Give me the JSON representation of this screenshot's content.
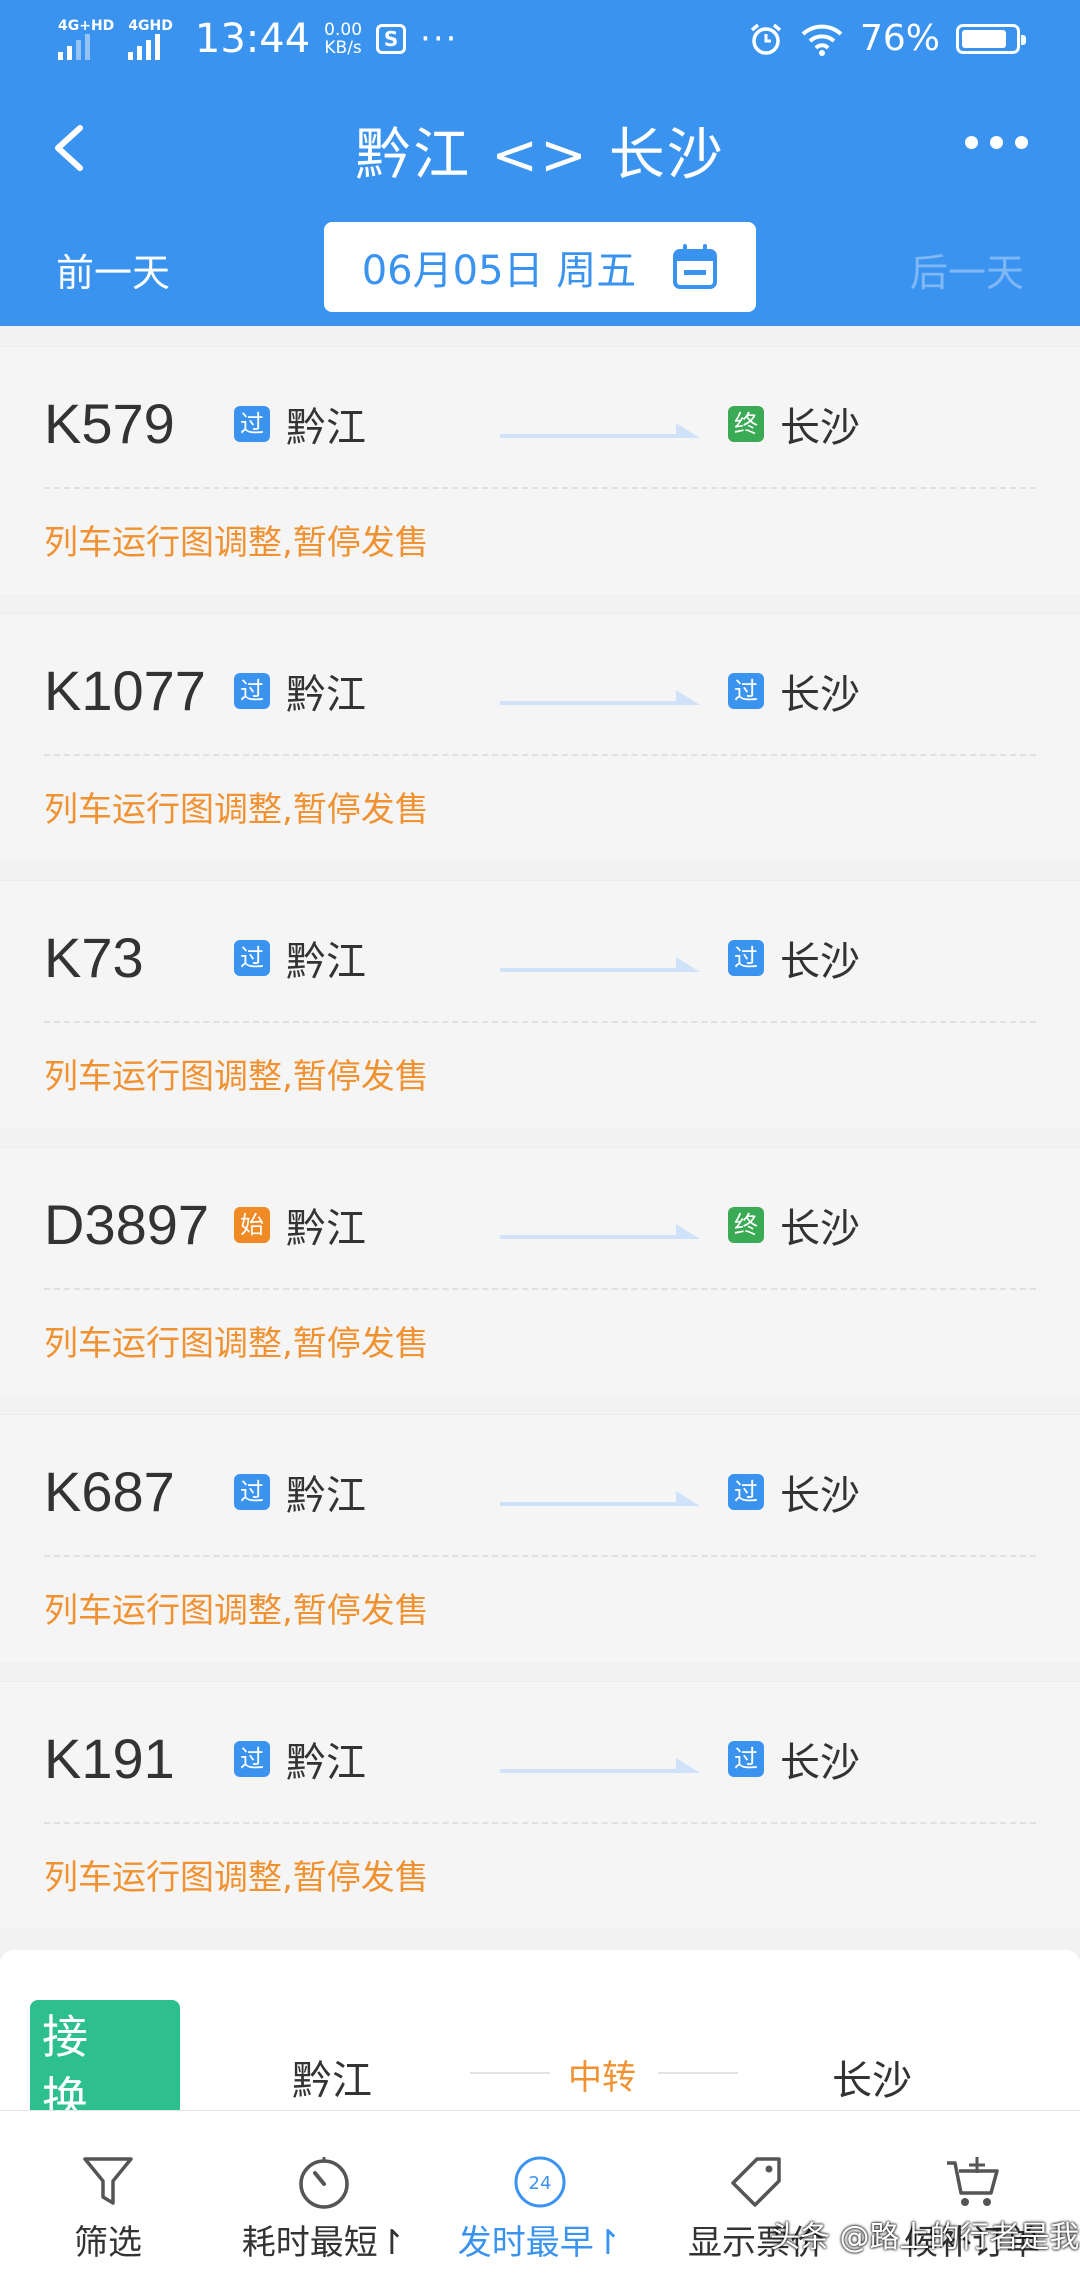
{
  "status_bar": {
    "net1": "4G+HD",
    "net2": "4GHD",
    "time": "13:44",
    "speed_value": "0.00",
    "speed_unit": "KB/s",
    "more": "···",
    "battery": "76%",
    "battery_level": 0.76
  },
  "header": {
    "title": "黔江 <> 长沙",
    "prev_day": "前一天",
    "date": "06月05日 周五",
    "next_day": "后一天"
  },
  "trains": [
    {
      "no": "K579",
      "from_tag": "过",
      "from": "黔江",
      "to_tag": "终",
      "to": "长沙",
      "notice": "列车运行图调整,暂停发售"
    },
    {
      "no": "K1077",
      "from_tag": "过",
      "from": "黔江",
      "to_tag": "过",
      "to": "长沙",
      "notice": "列车运行图调整,暂停发售"
    },
    {
      "no": "K73",
      "from_tag": "过",
      "from": "黔江",
      "to_tag": "过",
      "to": "长沙",
      "notice": "列车运行图调整,暂停发售"
    },
    {
      "no": "D3897",
      "from_tag": "始",
      "from": "黔江",
      "to_tag": "终",
      "to": "长沙",
      "notice": "列车运行图调整,暂停发售"
    },
    {
      "no": "K687",
      "from_tag": "过",
      "from": "黔江",
      "to_tag": "过",
      "to": "长沙",
      "notice": "列车运行图调整,暂停发售"
    },
    {
      "no": "K191",
      "from_tag": "过",
      "from": "黔江",
      "to_tag": "过",
      "to": "长沙",
      "notice": "列车运行图调整,暂停发售"
    }
  ],
  "transfer": {
    "badge": "接 换 续 乘",
    "from": "黔江",
    "middle": "中转",
    "to": "长沙"
  },
  "toolbar": {
    "filter": "筛选",
    "shortest": "耗时最短↾",
    "earliest": "发时最早↾",
    "show_price": "显示票价",
    "waitlist": "候补订单",
    "clock_text": "24"
  },
  "watermark": "头条 @路上的行者是我",
  "colors": {
    "brand": "#3b93f0",
    "notice": "#f09232",
    "pass_tag": "#3b93f0",
    "end_tag": "#3aaa55",
    "start_tag": "#f08a24",
    "transfer_badge": "#2ebf8e"
  }
}
